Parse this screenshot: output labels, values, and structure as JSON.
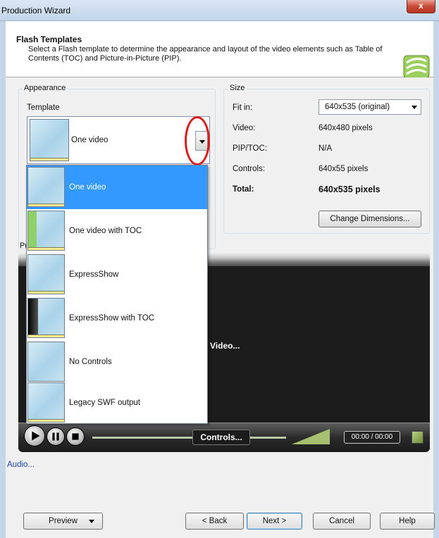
{
  "window": {
    "title": "Production Wizard",
    "close_glyph": "x"
  },
  "header": {
    "title": "Flash Templates",
    "description": "Select a Flash template to determine the appearance and layout of the video elements such as Table of Contents (TOC) and Picture-in-Picture (PIP)."
  },
  "appearance": {
    "group_label": "Appearance",
    "template_label": "Template",
    "selected_template": "One video",
    "options": [
      {
        "label": "One video",
        "thumb": "plain"
      },
      {
        "label": "One video with TOC",
        "thumb": "toc-green"
      },
      {
        "label": "ExpressShow",
        "thumb": "plain"
      },
      {
        "label": "ExpressShow with TOC",
        "thumb": "toc-dark"
      },
      {
        "label": "No Controls",
        "thumb": "no-controls"
      },
      {
        "label": "Legacy SWF output",
        "thumb": "plain"
      }
    ]
  },
  "size": {
    "group_label": "Size",
    "fit_in_label": "Fit in:",
    "fit_in_value": "640x535 (original)",
    "video_label": "Video:",
    "video_value": "640x480 pixels",
    "pip_label": "PIP/TOC:",
    "pip_value": "N/A",
    "controls_label": "Controls:",
    "controls_value": "640x55 pixels",
    "total_label": "Total:",
    "total_value": "640x535 pixels",
    "change_button": "Change Dimensions..."
  },
  "preview": {
    "group_label_partial": "Pr",
    "video_text": "Video...",
    "controls_text": "Controls...",
    "time": "00:00 / 00:00"
  },
  "audio_link": "Audio...",
  "footer": {
    "preview_button": "Preview",
    "back_button": "< Back",
    "next_button": "Next >",
    "cancel_button": "Cancel",
    "help_button": "Help"
  }
}
